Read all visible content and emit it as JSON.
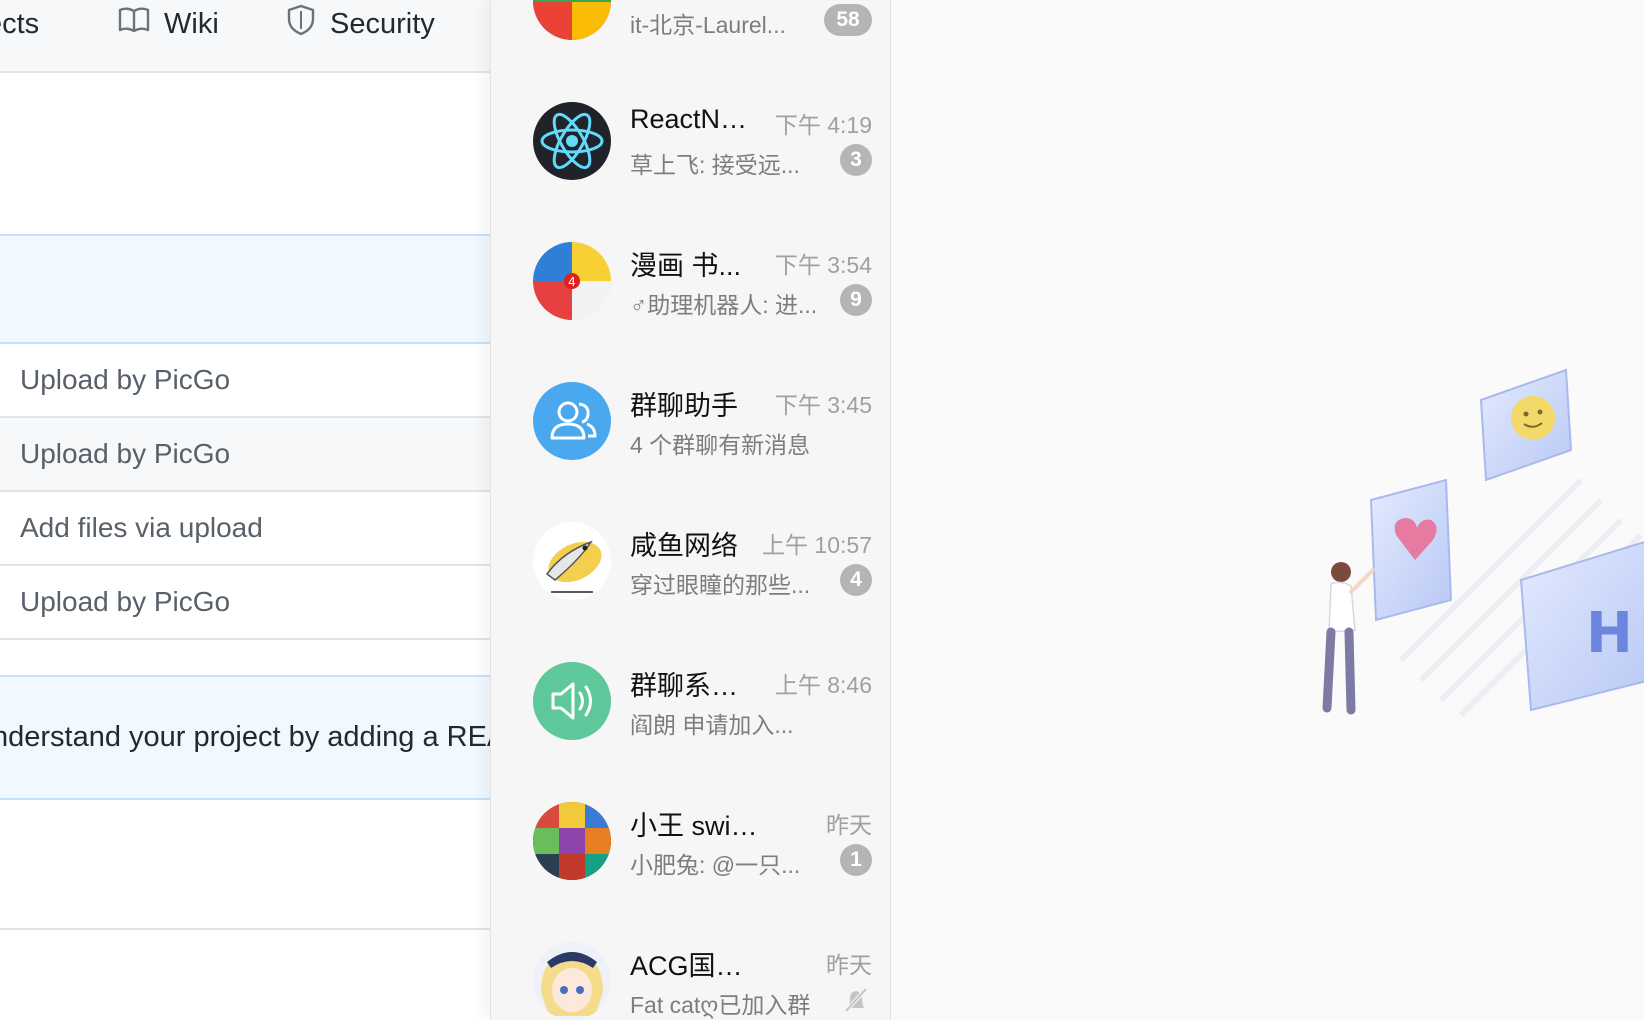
{
  "github": {
    "tabs": [
      {
        "label": "ects",
        "icon": "projects-icon"
      },
      {
        "label": "Wiki",
        "icon": "book-icon"
      },
      {
        "label": "Security",
        "icon": "shield-icon"
      }
    ],
    "commits": [
      "Upload by PicGo",
      "Upload by PicGo",
      "Add files via upload",
      "Upload by PicGo"
    ],
    "readme_banner": "nderstand your project by adding a README."
  },
  "chats": [
    {
      "name": "",
      "msg": "it-北京-Laurel...",
      "time": "",
      "badge": "58"
    },
    {
      "name": "ReactNative",
      "msg": "草上飞: 接受远...",
      "time": "下午 4:19",
      "badge": "3"
    },
    {
      "name": "漫画 书...",
      "msg": "♂助理机器人: 进...",
      "time": "下午 3:54",
      "badge": "9"
    },
    {
      "name": "群聊助手",
      "msg": "4 个群聊有新消息",
      "time": "下午 3:45",
      "badge": ""
    },
    {
      "name": "咸鱼网络",
      "msg": "穿过眼瞳的那些...",
      "time": "上午 10:57",
      "badge": "4"
    },
    {
      "name": "群聊系统消息",
      "msg": "阎朗 申请加入...",
      "time": "上午 8:46",
      "badge": ""
    },
    {
      "name": "小王 switch...",
      "msg": "小肥兔: @一只...",
      "time": "昨天",
      "badge": "1"
    },
    {
      "name": "ACG国际妹...",
      "msg": "Fat catღ已加入群",
      "time": "昨天",
      "badge": ""
    }
  ],
  "colors": {
    "chat_bg": "#f6f6f7",
    "badge": "#b5b5b5",
    "link": "#0366d6",
    "banner": "#f1f8ff"
  }
}
